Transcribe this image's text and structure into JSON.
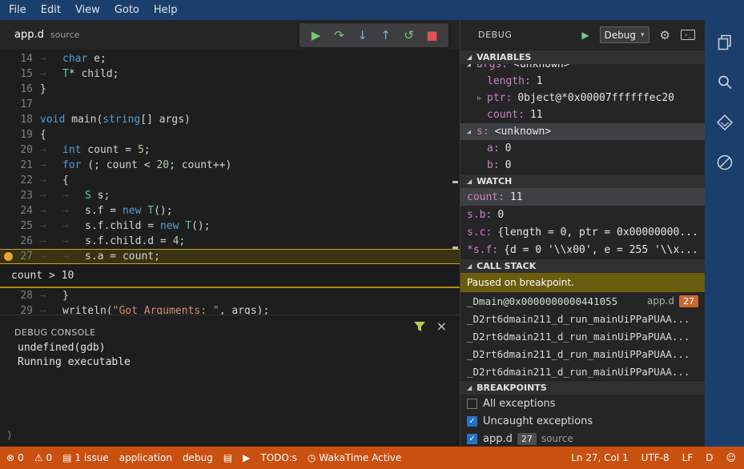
{
  "menubar": {
    "items": [
      "File",
      "Edit",
      "View",
      "Goto",
      "Help"
    ]
  },
  "activity_bar": {
    "icons": [
      "files",
      "search",
      "dub",
      "debug"
    ]
  },
  "glyphs": {
    "tab_arrow": "→",
    "twistie_expanded": "◢",
    "twistie_collapsed": "▷",
    "check": "✓",
    "caret": "▾"
  },
  "editor": {
    "tab": {
      "title": "app.d",
      "description": "source"
    },
    "toolbar": [
      {
        "name": "continue",
        "glyph": "▶",
        "color": "#75c775"
      },
      {
        "name": "step-over",
        "glyph": "↷",
        "color": "#75c775"
      },
      {
        "name": "step-into",
        "glyph": "↓",
        "color": "#6fb3e0"
      },
      {
        "name": "step-out",
        "glyph": "↑",
        "color": "#6fb3e0"
      },
      {
        "name": "restart",
        "glyph": "↺",
        "color": "#75c775"
      },
      {
        "name": "stop",
        "glyph": "■",
        "color": "#e05252"
      }
    ],
    "lines": [
      {
        "num": 14,
        "indent": 1,
        "tokens": [
          [
            "kw",
            "char"
          ],
          [
            "pl",
            " e;"
          ]
        ]
      },
      {
        "num": 15,
        "indent": 1,
        "tokens": [
          [
            "type",
            "T"
          ],
          [
            "pl",
            "* child;"
          ]
        ]
      },
      {
        "num": 16,
        "indent": 0,
        "tokens": [
          [
            "pl",
            "}"
          ]
        ]
      },
      {
        "num": 17,
        "indent": 0,
        "tokens": []
      },
      {
        "num": 18,
        "indent": 0,
        "tokens": [
          [
            "kw",
            "void"
          ],
          [
            "pl",
            " main("
          ],
          [
            "kw",
            "string"
          ],
          [
            "pl",
            "[] args)"
          ]
        ]
      },
      {
        "num": 19,
        "indent": 0,
        "tokens": [
          [
            "pl",
            "{"
          ]
        ]
      },
      {
        "num": 20,
        "indent": 1,
        "tokens": [
          [
            "kw",
            "int"
          ],
          [
            "pl",
            " count = "
          ],
          [
            "num",
            "5"
          ],
          [
            "pl",
            ";"
          ]
        ]
      },
      {
        "num": 21,
        "indent": 1,
        "tokens": [
          [
            "kw",
            "for"
          ],
          [
            "pl",
            " (; count < "
          ],
          [
            "num",
            "20"
          ],
          [
            "pl",
            "; count++)"
          ]
        ]
      },
      {
        "num": 22,
        "indent": 1,
        "tokens": [
          [
            "pl",
            "{"
          ]
        ]
      },
      {
        "num": 23,
        "indent": 2,
        "tokens": [
          [
            "type",
            "S"
          ],
          [
            "pl",
            " s;"
          ]
        ]
      },
      {
        "num": 24,
        "indent": 2,
        "tokens": [
          [
            "pl",
            "s.f = "
          ],
          [
            "kw",
            "new"
          ],
          [
            "pl",
            " "
          ],
          [
            "type",
            "T"
          ],
          [
            "pl",
            "();"
          ]
        ]
      },
      {
        "num": 25,
        "indent": 2,
        "tokens": [
          [
            "pl",
            "s.f.child = "
          ],
          [
            "kw",
            "new"
          ],
          [
            "pl",
            " "
          ],
          [
            "type",
            "T"
          ],
          [
            "pl",
            "();"
          ]
        ]
      },
      {
        "num": 26,
        "indent": 2,
        "tokens": [
          [
            "pl",
            "s.f.child.d = "
          ],
          [
            "num",
            "4"
          ],
          [
            "pl",
            ";"
          ]
        ]
      },
      {
        "num": 27,
        "indent": 2,
        "tokens": [
          [
            "pl",
            "s.a = count;"
          ]
        ],
        "current": true,
        "breakpoint": true
      },
      {
        "condition": "count > 10"
      },
      {
        "num": 28,
        "indent": 1,
        "tokens": [
          [
            "pl",
            "}"
          ]
        ]
      },
      {
        "num": 29,
        "indent": 1,
        "tokens": [
          [
            "pl",
            "writeln("
          ],
          [
            "str",
            "\"Got Arguments: \""
          ],
          [
            "pl",
            ", args);"
          ]
        ]
      }
    ]
  },
  "console": {
    "title": "DEBUG CONSOLE",
    "lines": [
      "undefined(gdb)",
      "Running executable"
    ],
    "prompt": "⟩",
    "close_glyph": "×"
  },
  "side": {
    "title": "DEBUG",
    "play_glyph": "▶",
    "config_label": "Debug",
    "gear_glyph": "⚙",
    "console_box_glyph": "›_"
  },
  "variables": {
    "title": "VARIABLES",
    "rows": [
      {
        "name": "args",
        "value": "<unknown>",
        "depth": 0,
        "twistie": "expanded",
        "clipped": true
      },
      {
        "name": "length",
        "value": "1",
        "depth": 2
      },
      {
        "name": "ptr",
        "value": "0bject@*0x00007ffffffec20",
        "depth": 1,
        "twistie": "collapsed"
      },
      {
        "name": "count",
        "value": "11",
        "depth": 2
      },
      {
        "name": "s",
        "value": "<unknown>",
        "depth": 0,
        "twistie": "expanded",
        "selected": true
      },
      {
        "name": "a",
        "value": "0",
        "depth": 2
      },
      {
        "name": "b",
        "value": "0",
        "depth": 2
      }
    ]
  },
  "watch": {
    "title": "WATCH",
    "rows": [
      {
        "name": "count",
        "value": "11",
        "selected": true
      },
      {
        "name": "s.b",
        "value": "0"
      },
      {
        "name": "s.c",
        "value": "{length = 0, ptr = 0x00000000..."
      },
      {
        "name": "*s.f",
        "value": "{d = 0 '\\\\x00', e = 255 '\\\\x..."
      }
    ]
  },
  "callstack": {
    "title": "CALL STACK",
    "message": "Paused on breakpoint.",
    "frames": [
      {
        "name": "_Dmain@0x0000000000441055",
        "file": "app.d",
        "badge": "27"
      },
      {
        "name": "_D2rt6dmain211_d_run_mainUiPPaPUAA..."
      },
      {
        "name": "_D2rt6dmain211_d_run_mainUiPPaPUAA..."
      },
      {
        "name": "_D2rt6dmain211_d_run_mainUiPPaPUAA..."
      },
      {
        "name": "_D2rt6dmain211_d_run_mainUiPPaPUAA..."
      }
    ]
  },
  "breakpoints": {
    "title": "BREAKPOINTS",
    "rows": [
      {
        "checked": false,
        "label": "All exceptions"
      },
      {
        "checked": true,
        "label": "Uncaught exceptions"
      },
      {
        "checked": true,
        "label": "app.d",
        "badge": "27",
        "description": "source"
      }
    ]
  },
  "statusbar": {
    "left": [
      {
        "name": "errors",
        "glyph": "⊗",
        "text": "0"
      },
      {
        "name": "warnings",
        "glyph": "⚠",
        "text": "0"
      },
      {
        "name": "issues",
        "glyph": "▤",
        "text": "1 issue"
      },
      {
        "name": "application",
        "text": "application"
      },
      {
        "name": "debug-config",
        "text": "debug"
      },
      {
        "name": "notes",
        "glyph": "▤"
      },
      {
        "name": "run",
        "glyph": "▶"
      },
      {
        "name": "todos",
        "text": "TODO:s"
      },
      {
        "name": "wakatime",
        "glyph": "◷",
        "text": "WakaTime Active"
      }
    ],
    "right": [
      {
        "name": "cursor-position",
        "text": "Ln 27, Col 1"
      },
      {
        "name": "encoding",
        "text": "UTF-8"
      },
      {
        "name": "eol",
        "text": "LF"
      },
      {
        "name": "language-mode",
        "text": "D"
      },
      {
        "name": "feedback",
        "glyph": "☺"
      }
    ]
  }
}
